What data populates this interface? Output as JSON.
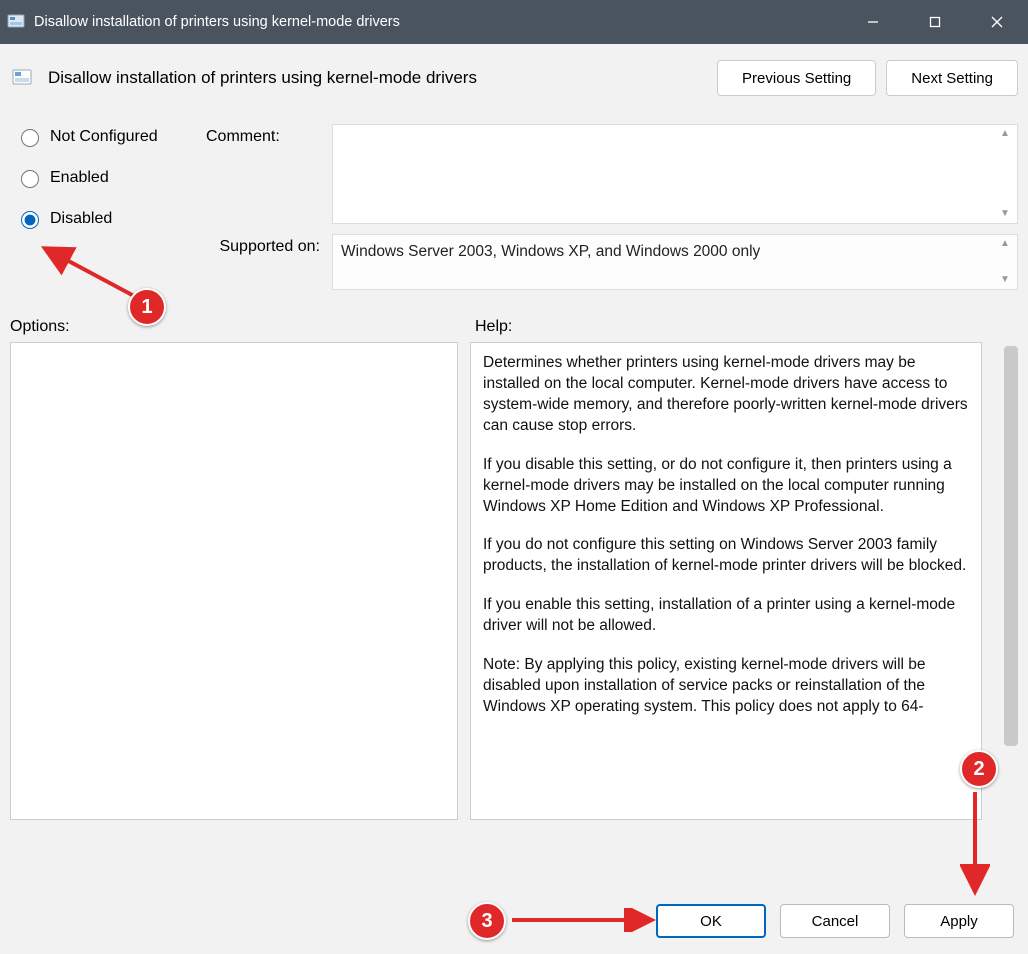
{
  "window": {
    "title": "Disallow installation of printers using kernel-mode drivers"
  },
  "header": {
    "policy_title": "Disallow installation of printers using kernel-mode drivers",
    "prev_btn": "Previous Setting",
    "next_btn": "Next Setting"
  },
  "state": {
    "options": [
      "Not Configured",
      "Enabled",
      "Disabled"
    ],
    "selected": "Disabled"
  },
  "fields": {
    "comment_label": "Comment:",
    "comment_value": "",
    "supported_label": "Supported on:",
    "supported_value": "Windows Server 2003, Windows XP, and Windows 2000 only"
  },
  "sections": {
    "options_label": "Options:",
    "help_label": "Help:"
  },
  "help": {
    "p1": "Determines whether printers using kernel-mode drivers may be installed on the local computer.  Kernel-mode drivers have access to system-wide memory, and therefore poorly-written kernel-mode drivers can cause stop errors.",
    "p2": "If you disable this setting, or do not configure it, then printers using a kernel-mode drivers may be installed on the local computer running Windows XP Home Edition and Windows XP Professional.",
    "p3": "If you do not configure this setting on Windows Server 2003 family products, the installation of kernel-mode printer drivers will be blocked.",
    "p4": "If you enable this setting, installation of a printer using a kernel-mode driver will not be allowed.",
    "p5": "Note: By applying this policy, existing kernel-mode drivers will be disabled upon installation of service packs or reinstallation of the Windows XP operating system. This policy does not apply to 64-"
  },
  "actions": {
    "ok": "OK",
    "cancel": "Cancel",
    "apply": "Apply"
  },
  "annotations": {
    "m1": "1",
    "m2": "2",
    "m3": "3"
  }
}
